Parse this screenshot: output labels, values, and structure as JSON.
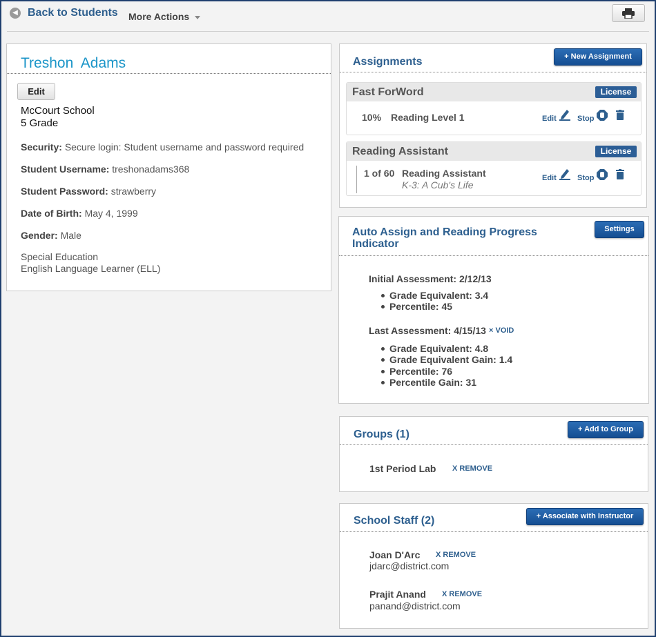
{
  "header": {
    "back_label": "Back to Students",
    "more_actions_label": "More Actions"
  },
  "student": {
    "name": "Treshon  Adams",
    "edit_label": "Edit",
    "school": "McCourt School",
    "grade": "5 Grade",
    "security_label": "Security:",
    "security_value": "Secure login: Student username and password required",
    "username_label": "Student Username:",
    "username_value": "treshonadams368",
    "password_label": "Student Password:",
    "password_value": "strawberry",
    "dob_label": "Date of Birth:",
    "dob_value": "May 4, 1999",
    "gender_label": "Gender:",
    "gender_value": "Male",
    "program_1": "Special Education",
    "program_2": "English Language Learner (ELL)"
  },
  "assignments": {
    "title": "Assignments",
    "new_button": "+ New Assignment",
    "programs": [
      {
        "name": "Fast ForWord",
        "license_label": "License",
        "progress": "10%",
        "item": "Reading Level 1",
        "subitem": "",
        "edit_label": "Edit",
        "stop_label": "Stop"
      },
      {
        "name": "Reading Assistant",
        "license_label": "License",
        "progress": "1 of 60",
        "item": "Reading Assistant",
        "subitem": "K-3: A Cub's Life",
        "edit_label": "Edit",
        "stop_label": "Stop"
      }
    ]
  },
  "auto_assign": {
    "title_line1": "Auto Assign and Reading Progress",
    "title_line2": "Indicator",
    "settings_button": "Settings",
    "initial_label": "Initial Assessment:",
    "initial_date": "2/12/13",
    "initial_items": [
      "Grade Equivalent: 3.4",
      "Percentile: 45"
    ],
    "last_label": "Last Assessment:",
    "last_date": "4/15/13",
    "void_label": "× VOID",
    "last_items": [
      "Grade Equivalent: 4.8",
      "Grade Equivalent Gain: 1.4",
      "Percentile: 76",
      "Percentile Gain: 31"
    ]
  },
  "groups": {
    "title": "Groups (1)",
    "add_button": "+ Add to Group",
    "items": [
      {
        "name": "1st Period Lab",
        "remove_label": "X REMOVE"
      }
    ]
  },
  "staff": {
    "title": "School Staff (2)",
    "associate_button": "+ Associate with Instructor",
    "items": [
      {
        "name": "Joan D'Arc",
        "email": "jdarc@district.com",
        "remove_label": "X REMOVE"
      },
      {
        "name": "Prajit Anand",
        "email": "panand@district.com",
        "remove_label": "X REMOVE"
      }
    ]
  },
  "colors": {
    "accent_blue": "#2d5f8f",
    "name_blue": "#1b95c8",
    "button_blue": "#154e92",
    "frame_border": "#1f3f6e"
  }
}
